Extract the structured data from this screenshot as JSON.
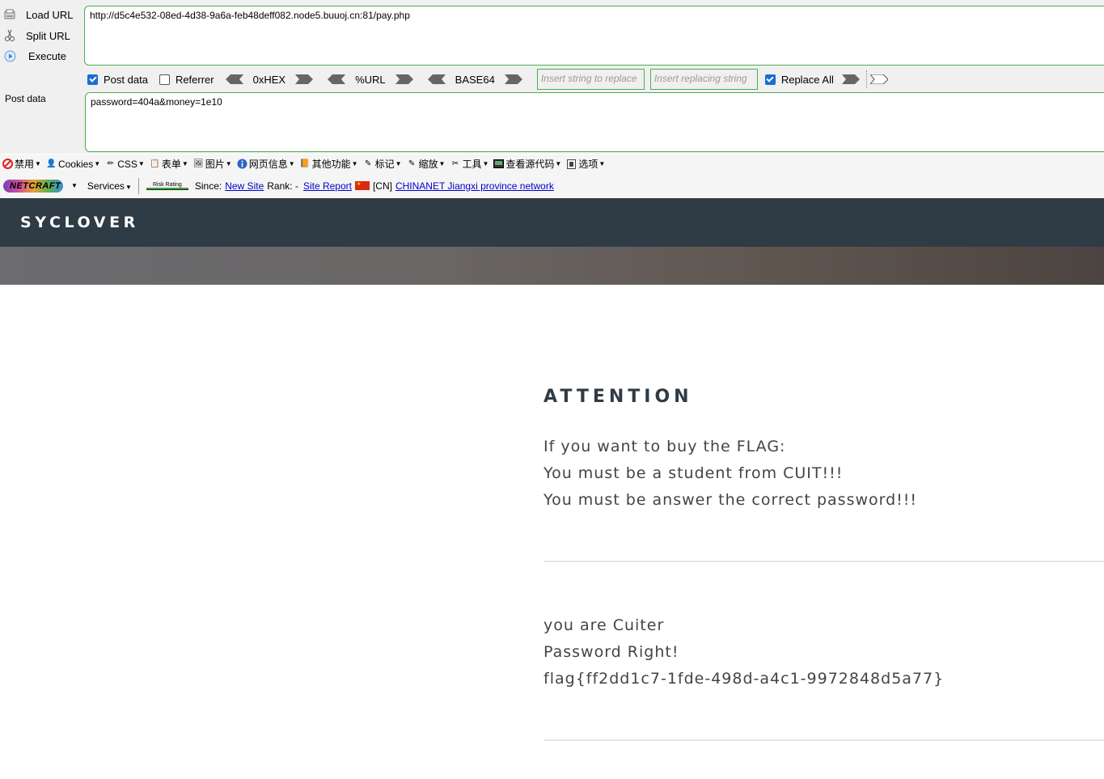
{
  "hackbar": {
    "actions": [
      {
        "label": "Load URL",
        "icon": "load-url-icon"
      },
      {
        "label": "Split URL",
        "icon": "split-url-icon"
      },
      {
        "label": "Execute",
        "icon": "execute-icon"
      }
    ],
    "url": "http://d5c4e532-08ed-4d38-9a6a-feb48deff082.node5.buuoj.cn:81/pay.php",
    "post_label": "Post data",
    "post_data": "password=404a&money=1e10",
    "options": {
      "post_data": {
        "label": "Post data",
        "checked": true
      },
      "referrer": {
        "label": "Referrer",
        "checked": false
      },
      "hex": "0xHEX",
      "url": "%URL",
      "base64": "BASE64",
      "replace_placeholder": "Insert string to replace",
      "replacing_placeholder": "Insert replacing string",
      "replace_all": {
        "label": "Replace All",
        "checked": true
      }
    }
  },
  "toolbar1": {
    "items": [
      "禁用",
      "Cookies",
      "CSS",
      "表单",
      "图片",
      "网页信息",
      "其他功能",
      "标记",
      "缩放",
      "工具",
      "查看源代码",
      "选项"
    ]
  },
  "toolbar2": {
    "netcraft": "NETCRAFT",
    "services": "Services",
    "risk_rating": "Risk Rating",
    "since_label": "Since:",
    "since_link": "New Site",
    "rank_label": "Rank: -",
    "site_report": "Site Report",
    "country": "[CN]",
    "network": "CHINANET Jiangxi province network"
  },
  "site": {
    "brand": "SYCLOVER",
    "title": "ATTENTION",
    "intro": [
      "If you want to buy the FLAG:",
      "You must be a student from CUIT!!!",
      "You must be answer the correct password!!!"
    ],
    "result": [
      "you are Cuiter",
      "Password Right!",
      "flag{ff2dd1c7-1fde-498d-a4c1-9972848d5a77}"
    ]
  },
  "colors": {
    "navbar": "#2f3b45",
    "input_border": "#4caf50",
    "checkbox": "#1a6fd0",
    "link": "#0000cc"
  }
}
